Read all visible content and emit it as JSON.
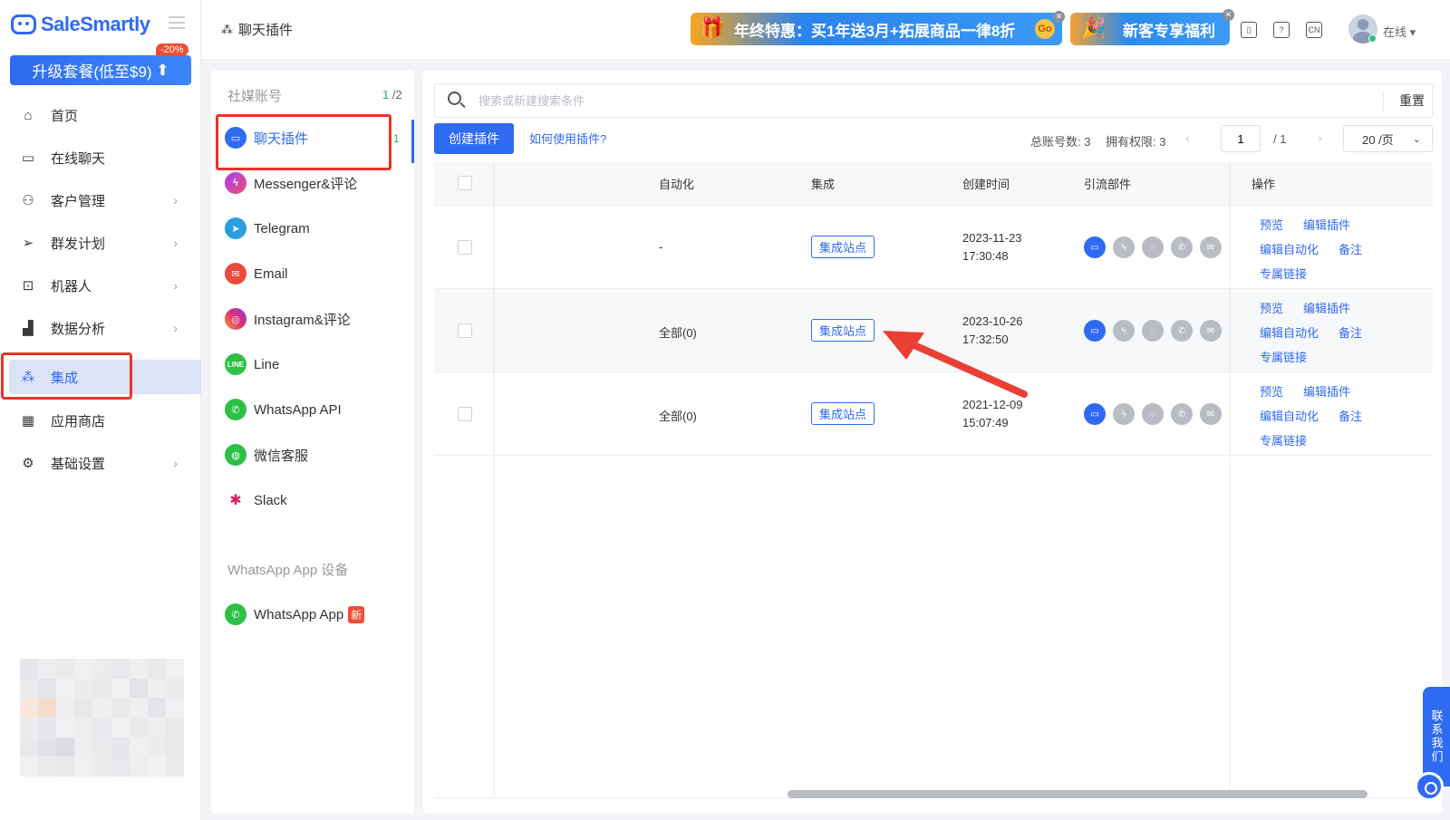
{
  "app": {
    "brand": "SaleSmartly",
    "upgrade": "升级套餐(低至$9)",
    "discount": "-20%"
  },
  "sidebar": {
    "items": [
      {
        "label": "首页",
        "icon": "home-icon"
      },
      {
        "label": "在线聊天",
        "icon": "chat-icon"
      },
      {
        "label": "客户管理",
        "icon": "customers-icon"
      },
      {
        "label": "群发计划",
        "icon": "send-icon"
      },
      {
        "label": "机器人",
        "icon": "robot-icon"
      },
      {
        "label": "数据分析",
        "icon": "chart-icon"
      },
      {
        "label": "集成",
        "icon": "integration-icon"
      },
      {
        "label": "应用商店",
        "icon": "apps-icon"
      },
      {
        "label": "基础设置",
        "icon": "settings-icon"
      }
    ]
  },
  "header": {
    "title": "聊天插件",
    "promo1": "年终特惠：买1年送3月+拓展商品一律8折",
    "promo1_go": "Go",
    "promo2": "新客专享福利",
    "lang": "CN",
    "status": "在线"
  },
  "channels": {
    "section": "社媒账号",
    "count_used": "1",
    "count_total": "/2",
    "items": [
      {
        "label": "聊天插件",
        "count": "1"
      },
      {
        "label": "Messenger&评论"
      },
      {
        "label": "Telegram"
      },
      {
        "label": "Email"
      },
      {
        "label": "Instagram&评论"
      },
      {
        "label": "Line"
      },
      {
        "label": "WhatsApp API"
      },
      {
        "label": "微信客服"
      },
      {
        "label": "Slack"
      }
    ],
    "wa_section": "WhatsApp App 设备",
    "wa_item": "WhatsApp App",
    "wa_new": "新"
  },
  "toolbar": {
    "search_placeholder": "搜索或新建搜索条件",
    "reset": "重置",
    "create": "创建插件",
    "howto": "如何使用插件?",
    "total": "总账号数: 3",
    "perm": "拥有权限: 3",
    "page": "1",
    "page_of": "/  1",
    "page_size": "20 /页"
  },
  "table": {
    "columns": [
      "自动化",
      "集成",
      "创建时间",
      "引流部件",
      "操作"
    ],
    "rows": [
      {
        "automation": "-",
        "integration": "集成站点",
        "date": "2023-11-23",
        "time": "17:30:48"
      },
      {
        "automation": "全部(0)",
        "integration": "集成站点",
        "date": "2023-10-26",
        "time": "17:32:50"
      },
      {
        "automation": "全部(0)",
        "integration": "集成站点",
        "date": "2021-12-09",
        "time": "15:07:49"
      }
    ],
    "ops": {
      "preview": "预览",
      "edit": "编辑插件",
      "auto": "编辑自动化",
      "note": "备注",
      "link": "专属链接"
    }
  },
  "contact": "联系我们"
}
